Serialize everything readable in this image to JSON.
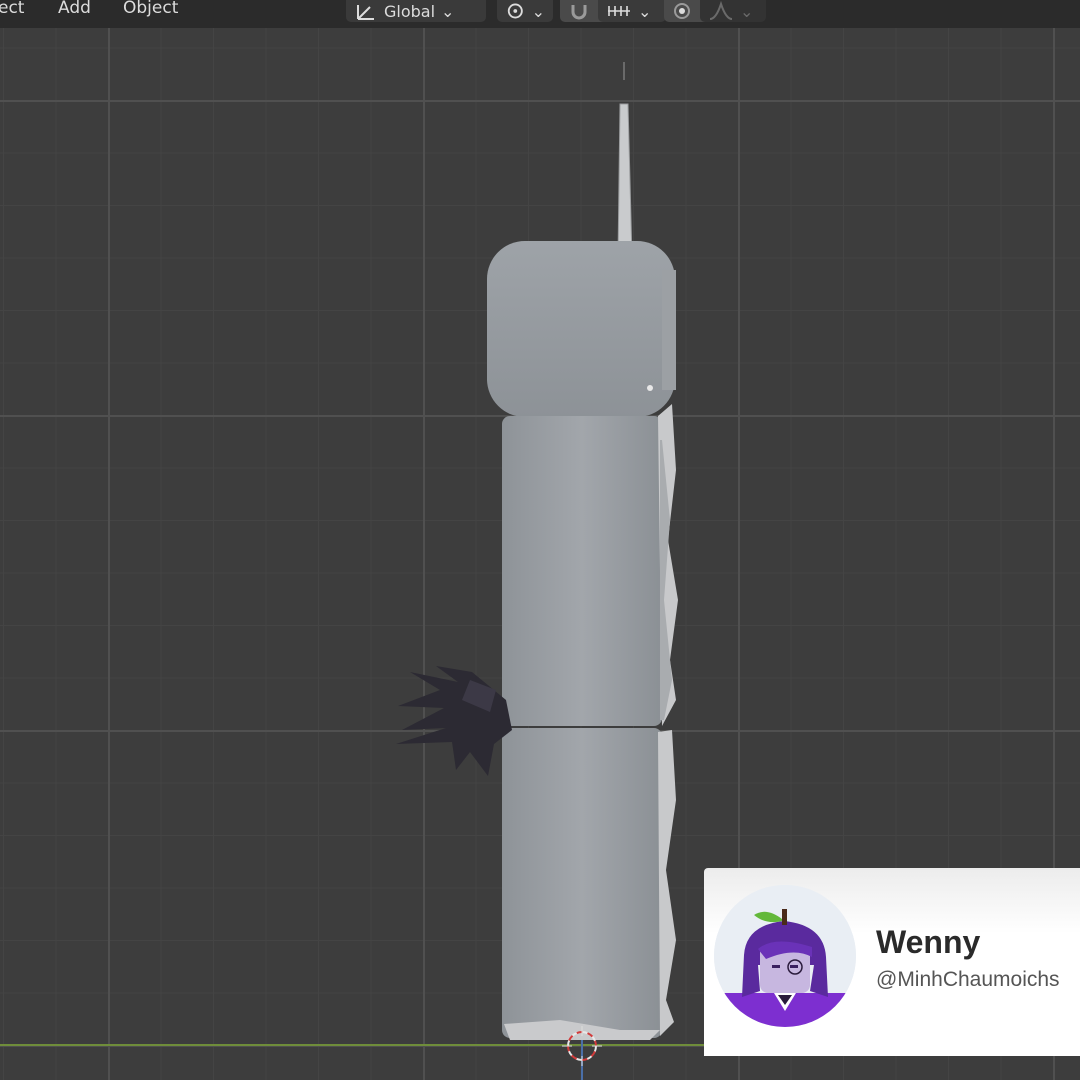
{
  "header": {
    "menus": [
      "ect",
      "Add",
      "Object"
    ],
    "transform_orientation": "Global",
    "icons": {
      "orientation": "transform-orientation-icon",
      "pivot": "pivot-point-icon",
      "snap": "snap-magnet-icon",
      "snap_increment": "snap-increment-icon",
      "proportional": "proportional-editing-icon",
      "falloff": "falloff-curve-icon"
    }
  },
  "viewport": {
    "background": "#3d3d3d",
    "x_axis_color": "#6f8d3a",
    "z_axis_color": "#4a6fa8"
  },
  "card": {
    "name": "Wenny",
    "handle": "@MinhChaumoichs",
    "avatar_icon": "eggplant-avatar-icon"
  }
}
